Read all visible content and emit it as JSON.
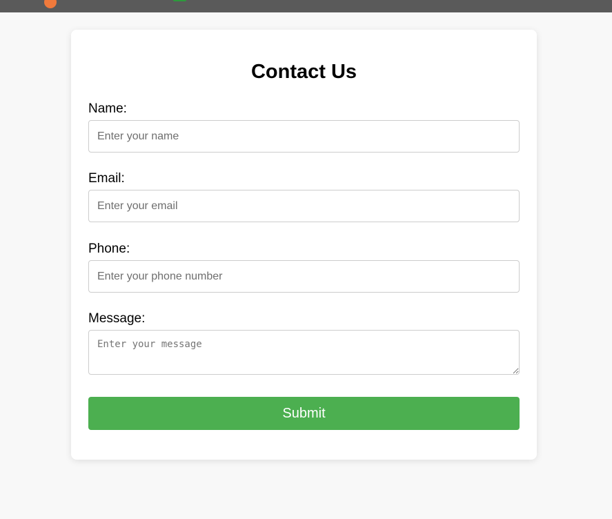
{
  "form": {
    "title": "Contact Us",
    "name": {
      "label": "Name:",
      "placeholder": "Enter your name",
      "value": ""
    },
    "email": {
      "label": "Email:",
      "placeholder": "Enter your email",
      "value": ""
    },
    "phone": {
      "label": "Phone:",
      "placeholder": "Enter your phone number",
      "value": ""
    },
    "message": {
      "label": "Message:",
      "placeholder": "Enter your message",
      "value": ""
    },
    "submit_label": "Submit"
  },
  "colors": {
    "submit_bg": "#4caf50",
    "page_bg": "#f8f8f8",
    "topbar_bg": "#5a5a5a"
  }
}
